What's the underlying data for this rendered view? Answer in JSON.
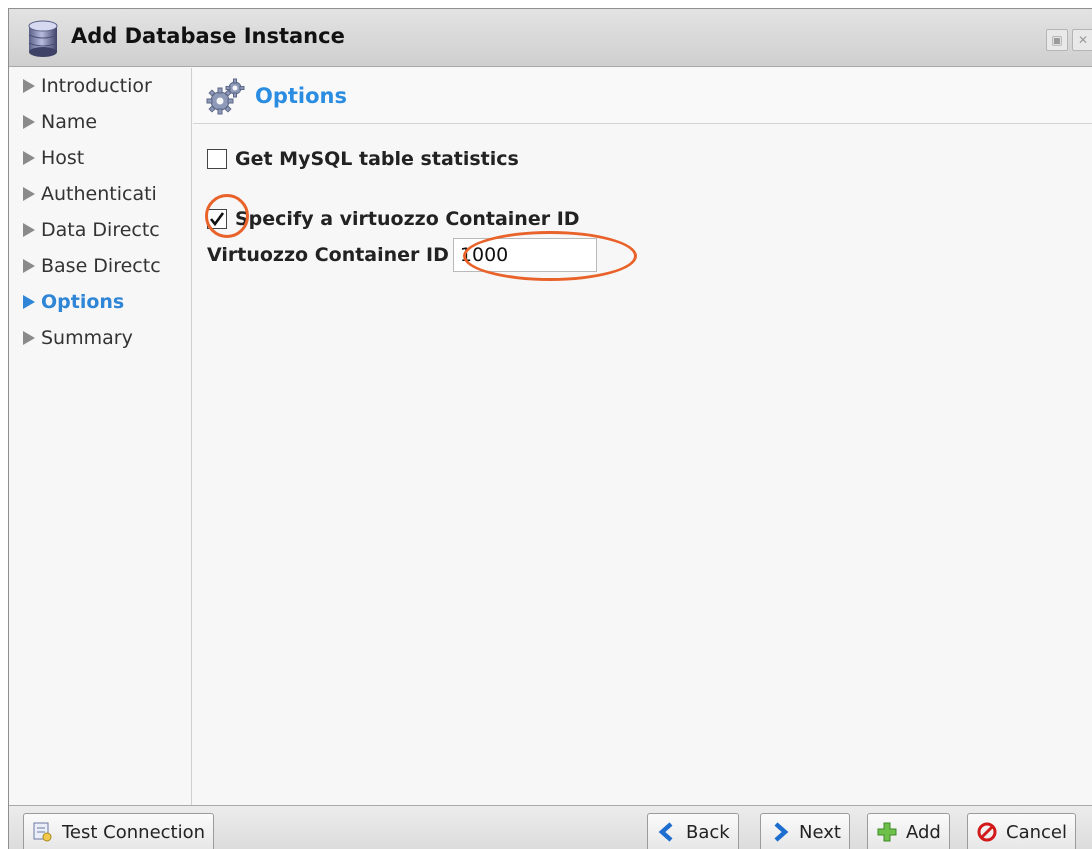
{
  "window": {
    "title": "Add Database Instance",
    "icon": "database-icon",
    "controls": [
      "restore-icon",
      "close-icon"
    ]
  },
  "sidebar": {
    "items": [
      {
        "label": "Introductior",
        "active": false
      },
      {
        "label": "Name",
        "active": false
      },
      {
        "label": "Host",
        "active": false
      },
      {
        "label": "Authenticati",
        "active": false
      },
      {
        "label": "Data Directc",
        "active": false
      },
      {
        "label": "Base Directc",
        "active": false
      },
      {
        "label": "Options",
        "active": true
      },
      {
        "label": "Summary",
        "active": false
      }
    ]
  },
  "main": {
    "section_title": "Options",
    "section_icon": "gears-icon",
    "mysql_stats": {
      "label": "Get MySQL table statistics",
      "checked": false
    },
    "virtuozzo": {
      "label": "Specify a virtuozzo Container ID",
      "checked": true
    },
    "container_id": {
      "label": "Virtuozzo Container ID",
      "value": "1000"
    },
    "highlight_color": "#e8622a",
    "accent_color": "#2a8de2"
  },
  "footer": {
    "test_connection": "Test Connection",
    "back": "Back",
    "next": "Next",
    "add": "Add",
    "cancel": "Cancel"
  }
}
